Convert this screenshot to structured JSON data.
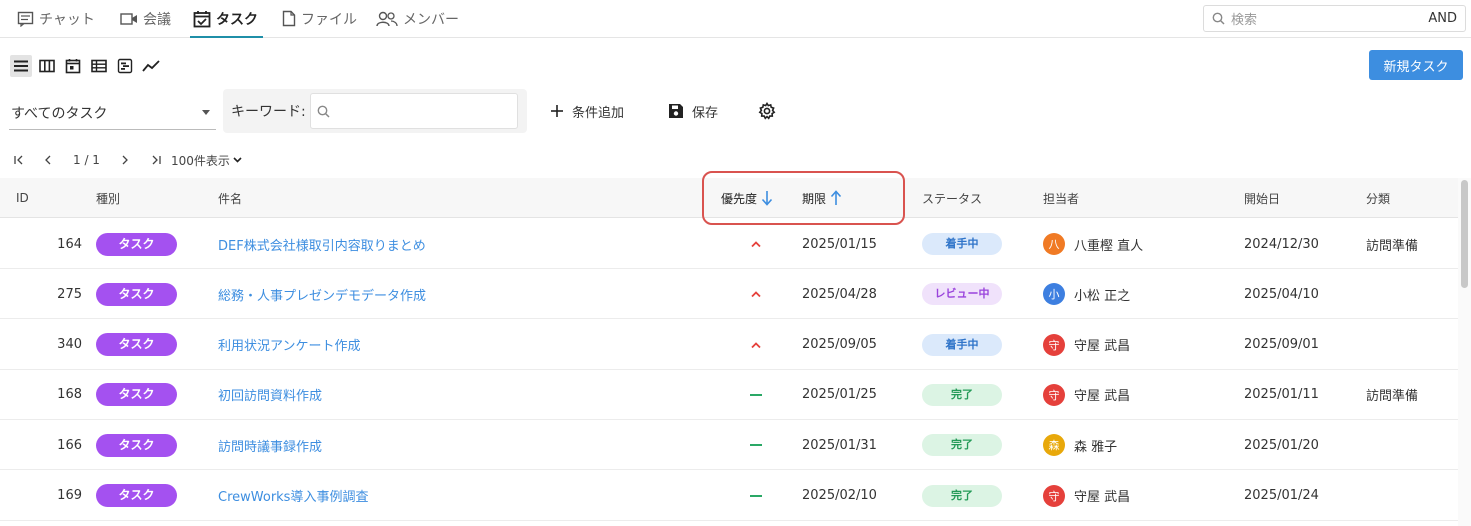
{
  "nav": {
    "tabs": [
      {
        "label": "チャット",
        "icon": "chat-icon"
      },
      {
        "label": "会議",
        "icon": "video-icon"
      },
      {
        "label": "タスク",
        "icon": "calendar-check-icon",
        "active": true
      },
      {
        "label": "ファイル",
        "icon": "file-icon"
      },
      {
        "label": "メンバー",
        "icon": "members-icon"
      }
    ],
    "search": {
      "placeholder": "検索",
      "mode": "AND"
    }
  },
  "toolbar": {
    "views": [
      "list-view",
      "board-view",
      "calendar-view",
      "table-view",
      "gantt-view",
      "chart-view"
    ],
    "active_view": "list-view",
    "new_task_label": "新規タスク"
  },
  "filters": {
    "task_select": "すべてのタスク",
    "keyword_label": "キーワード:",
    "keyword_value": "",
    "add_condition_label": "条件追加",
    "save_label": "保存"
  },
  "pager": {
    "current": "1 / 1",
    "per_page": "100件表示"
  },
  "table": {
    "columns": {
      "id": "ID",
      "kind": "種別",
      "title": "件名",
      "priority": "優先度",
      "due": "期限",
      "status": "ステータス",
      "assignee": "担当者",
      "start": "開始日",
      "category": "分類"
    },
    "sort": {
      "priority": "desc",
      "due": "asc"
    },
    "rows": [
      {
        "id": "164",
        "kind": "タスク",
        "title": "DEF株式会社様取引内容取りまとめ",
        "priority": "high",
        "due": "2025/01/15",
        "status": "着手中",
        "status_type": "inprogress",
        "avatar_char": "八",
        "avatar_color": "#f07a24",
        "assignee": "八重樫 直人",
        "start": "2024/12/30",
        "category": "訪問準備"
      },
      {
        "id": "275",
        "kind": "タスク",
        "title": "総務・人事プレゼンデモデータ作成",
        "priority": "high",
        "due": "2025/04/28",
        "status": "レビュー中",
        "status_type": "review",
        "avatar_char": "小",
        "avatar_color": "#3d7fe0",
        "assignee": "小松 正之",
        "start": "2025/04/10",
        "category": ""
      },
      {
        "id": "340",
        "kind": "タスク",
        "title": "利用状況アンケート作成",
        "priority": "high",
        "due": "2025/09/05",
        "status": "着手中",
        "status_type": "inprogress",
        "avatar_char": "守",
        "avatar_color": "#e5403b",
        "assignee": "守屋 武昌",
        "start": "2025/09/01",
        "category": ""
      },
      {
        "id": "168",
        "kind": "タスク",
        "title": "初回訪問資料作成",
        "priority": "normal",
        "due": "2025/01/25",
        "status": "完了",
        "status_type": "done",
        "avatar_char": "守",
        "avatar_color": "#e5403b",
        "assignee": "守屋 武昌",
        "start": "2025/01/11",
        "category": "訪問準備"
      },
      {
        "id": "166",
        "kind": "タスク",
        "title": "訪問時議事録作成",
        "priority": "normal",
        "due": "2025/01/31",
        "status": "完了",
        "status_type": "done",
        "avatar_char": "森",
        "avatar_color": "#e8a80a",
        "assignee": "森 雅子",
        "start": "2025/01/20",
        "category": ""
      },
      {
        "id": "169",
        "kind": "タスク",
        "title": "CrewWorks導入事例調査",
        "priority": "normal",
        "due": "2025/02/10",
        "status": "完了",
        "status_type": "done",
        "avatar_char": "守",
        "avatar_color": "#e5403b",
        "assignee": "守屋 武昌",
        "start": "2025/01/24",
        "category": ""
      }
    ]
  },
  "colors": {
    "accent": "#3d8ee0",
    "kind_badge": "#a451f0",
    "priority_high": "#e5403b",
    "priority_normal": "#2aa866",
    "highlight": "#d9534f"
  }
}
